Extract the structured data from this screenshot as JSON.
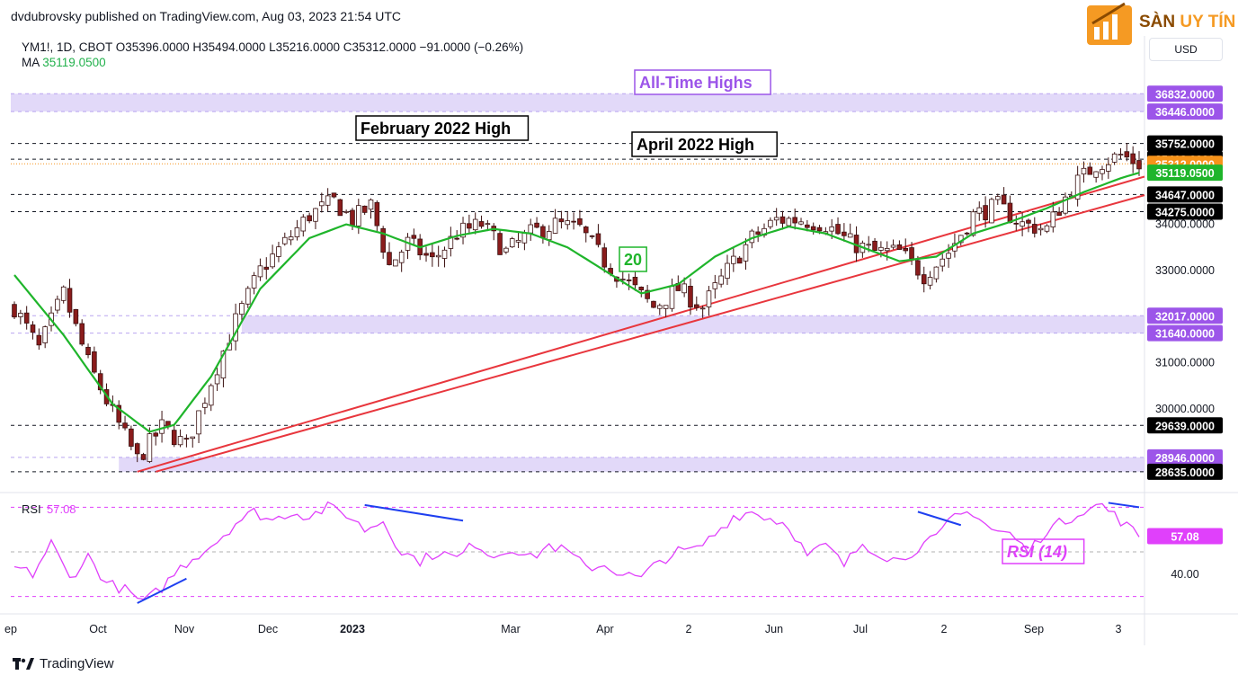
{
  "header": {
    "publisher": "dvdubrovsky published on TradingView.com, Aug 03, 2023 21:54 UTC",
    "symbol_line": "YM1!, 1D, CBOT  O35396.0000  H35494.0000  L35216.0000  C35312.0000  −91.0000 (−0.26%)",
    "ma_label": "MA",
    "ma_value": "35119.0500",
    "currency": "USD"
  },
  "logo": {
    "text_a": "SÀN ",
    "text_b": "UY TÍN",
    "accent": "#f59a23"
  },
  "footer": {
    "brand": "TradingView"
  },
  "colors": {
    "up": "#26a69a",
    "down": "#000000",
    "candle": "#8a1c1c",
    "ma": "#1fb52b",
    "trendline": "#e8363d",
    "zone": "#d8ccf7",
    "rsi": "#e040fb",
    "div_line": "#1e3ff0",
    "last_price": "#f7931a",
    "annotation_purple": "#9c55e9"
  },
  "chart_data": {
    "type": "candlestick",
    "symbol": "YM1!",
    "interval": "1D",
    "price_axis": {
      "min": 28300,
      "max": 37500,
      "tick_labels": [
        "34000.0000",
        "33000.0000",
        "31000.0000",
        "30000.0000"
      ],
      "ticks": [
        34000,
        33000,
        31000,
        30000
      ]
    },
    "time_axis": {
      "labels": [
        "ep",
        "Oct",
        "Nov",
        "Dec",
        "2023",
        "Mar",
        "Apr",
        "2",
        "Jun",
        "Jul",
        "2",
        "Sep",
        "3"
      ],
      "bold": [
        "2023"
      ]
    },
    "levels": [
      {
        "value": 36832,
        "label": "36832.0000",
        "style": "zone",
        "bg": "#9c55e9"
      },
      {
        "value": 36446,
        "label": "36446.0000",
        "style": "zone",
        "bg": "#9c55e9"
      },
      {
        "value": 35752,
        "label": "35752.0000",
        "style": "dashed",
        "bg": "#000000"
      },
      {
        "value": 35413,
        "label": "35413.0000",
        "style": "dashed",
        "bg": "#000000"
      },
      {
        "value": 35312,
        "label": "35312.0000",
        "style": "last",
        "bg": "#f7931a"
      },
      {
        "value": 35119.05,
        "label": "35119.0500",
        "style": "ma",
        "bg": "#1fb52b"
      },
      {
        "value": 34647,
        "label": "34647.0000",
        "style": "dashed",
        "bg": "#000000"
      },
      {
        "value": 34275,
        "label": "34275.0000",
        "style": "dashed",
        "bg": "#000000"
      },
      {
        "value": 32017,
        "label": "32017.0000",
        "style": "zone",
        "bg": "#9c55e9"
      },
      {
        "value": 31640,
        "label": "31640.0000",
        "style": "zone",
        "bg": "#9c55e9"
      },
      {
        "value": 29639,
        "label": "29639.0000",
        "style": "dashed",
        "bg": "#000000"
      },
      {
        "value": 28946,
        "label": "28946.0000",
        "style": "zone",
        "bg": "#9c55e9"
      },
      {
        "value": 28635,
        "label": "28635.0000",
        "style": "dashed",
        "bg": "#000000"
      }
    ],
    "zones": [
      [
        36446,
        36832
      ],
      [
        31640,
        32017
      ],
      [
        28635,
        28946
      ]
    ],
    "annotations": {
      "all_time_highs": "All-Time Highs",
      "feb_2022_high": "February 2022 High",
      "apr_2022_high": "April 2022 High",
      "ma_period": "20",
      "rsi_label": "RSI (14)"
    },
    "close_series_anchors": [
      [
        0,
        32200
      ],
      [
        4,
        31300
      ],
      [
        8,
        32500
      ],
      [
        12,
        31000
      ],
      [
        16,
        29900
      ],
      [
        20,
        28900
      ],
      [
        24,
        29600
      ],
      [
        28,
        29200
      ],
      [
        32,
        30600
      ],
      [
        36,
        31900
      ],
      [
        40,
        33000
      ],
      [
        44,
        33600
      ],
      [
        48,
        34200
      ],
      [
        52,
        34500
      ],
      [
        55,
        34100
      ],
      [
        58,
        34400
      ],
      [
        61,
        33100
      ],
      [
        64,
        33600
      ],
      [
        68,
        33200
      ],
      [
        72,
        33800
      ],
      [
        76,
        34000
      ],
      [
        80,
        33400
      ],
      [
        84,
        33800
      ],
      [
        88,
        34000
      ],
      [
        92,
        33900
      ],
      [
        96,
        33200
      ],
      [
        100,
        32700
      ],
      [
        104,
        32200
      ],
      [
        108,
        32600
      ],
      [
        112,
        32200
      ],
      [
        116,
        33000
      ],
      [
        120,
        33700
      ],
      [
        124,
        34100
      ],
      [
        128,
        34100
      ],
      [
        132,
        34000
      ],
      [
        136,
        33600
      ],
      [
        140,
        33400
      ],
      [
        144,
        33400
      ],
      [
        148,
        32900
      ],
      [
        152,
        33400
      ],
      [
        156,
        34200
      ],
      [
        160,
        34400
      ],
      [
        164,
        34000
      ],
      [
        168,
        33900
      ],
      [
        172,
        34800
      ],
      [
        176,
        35300
      ],
      [
        180,
        35500
      ],
      [
        183,
        35312
      ]
    ],
    "ma_anchors": [
      [
        0,
        32900
      ],
      [
        8,
        31600
      ],
      [
        16,
        30100
      ],
      [
        22,
        29500
      ],
      [
        26,
        29650
      ],
      [
        32,
        30700
      ],
      [
        40,
        32600
      ],
      [
        48,
        33700
      ],
      [
        54,
        34000
      ],
      [
        60,
        33800
      ],
      [
        66,
        33500
      ],
      [
        72,
        33750
      ],
      [
        78,
        33900
      ],
      [
        84,
        33800
      ],
      [
        90,
        33500
      ],
      [
        96,
        33000
      ],
      [
        102,
        32500
      ],
      [
        108,
        32700
      ],
      [
        114,
        33300
      ],
      [
        120,
        33700
      ],
      [
        126,
        33950
      ],
      [
        132,
        33800
      ],
      [
        138,
        33500
      ],
      [
        144,
        33200
      ],
      [
        150,
        33300
      ],
      [
        156,
        33800
      ],
      [
        162,
        34050
      ],
      [
        168,
        34350
      ],
      [
        174,
        34700
      ],
      [
        180,
        35000
      ],
      [
        183,
        35119.05
      ]
    ],
    "trendlines": [
      {
        "from": [
          20,
          28635
        ],
        "to": [
          183,
          35000
        ]
      },
      {
        "from": [
          23,
          28635
        ],
        "to": [
          183,
          34600
        ]
      }
    ],
    "rsi": {
      "title": "RSI",
      "value": "57.08",
      "levels": [
        30,
        70
      ],
      "tick_labels": [
        "40.00"
      ],
      "ticks": [
        40
      ],
      "range": [
        25,
        75
      ],
      "anchors": [
        [
          0,
          43
        ],
        [
          3,
          40
        ],
        [
          6,
          54
        ],
        [
          9,
          38
        ],
        [
          12,
          48
        ],
        [
          15,
          36
        ],
        [
          18,
          33
        ],
        [
          21,
          27
        ],
        [
          24,
          34
        ],
        [
          27,
          43
        ],
        [
          30,
          49
        ],
        [
          33,
          55
        ],
        [
          36,
          63
        ],
        [
          39,
          68
        ],
        [
          42,
          64
        ],
        [
          45,
          68
        ],
        [
          48,
          66
        ],
        [
          51,
          70
        ],
        [
          54,
          67
        ],
        [
          57,
          60
        ],
        [
          60,
          64
        ],
        [
          63,
          50
        ],
        [
          66,
          46
        ],
        [
          69,
          50
        ],
        [
          72,
          47
        ],
        [
          75,
          54
        ],
        [
          78,
          48
        ],
        [
          81,
          52
        ],
        [
          84,
          47
        ],
        [
          87,
          53
        ],
        [
          90,
          50
        ],
        [
          93,
          43
        ],
        [
          96,
          44
        ],
        [
          99,
          40
        ],
        [
          102,
          38
        ],
        [
          105,
          46
        ],
        [
          108,
          50
        ],
        [
          111,
          51
        ],
        [
          114,
          58
        ],
        [
          117,
          66
        ],
        [
          120,
          68
        ],
        [
          123,
          65
        ],
        [
          126,
          62
        ],
        [
          129,
          48
        ],
        [
          132,
          53
        ],
        [
          135,
          44
        ],
        [
          138,
          54
        ],
        [
          141,
          49
        ],
        [
          144,
          46
        ],
        [
          147,
          52
        ],
        [
          150,
          56
        ],
        [
          153,
          66
        ],
        [
          156,
          68
        ],
        [
          159,
          60
        ],
        [
          162,
          58
        ],
        [
          165,
          50
        ],
        [
          168,
          60
        ],
        [
          171,
          64
        ],
        [
          174,
          69
        ],
        [
          177,
          71
        ],
        [
          180,
          64
        ],
        [
          183,
          57
        ]
      ],
      "divergence_lines": [
        {
          "from": [
            20,
            27
          ],
          "to": [
            28,
            38
          ]
        },
        {
          "from": [
            57,
            71
          ],
          "to": [
            73,
            64
          ]
        },
        {
          "from": [
            147,
            68
          ],
          "to": [
            154,
            62
          ]
        },
        {
          "from": [
            178,
            72
          ],
          "to": [
            183,
            70
          ]
        }
      ]
    }
  }
}
